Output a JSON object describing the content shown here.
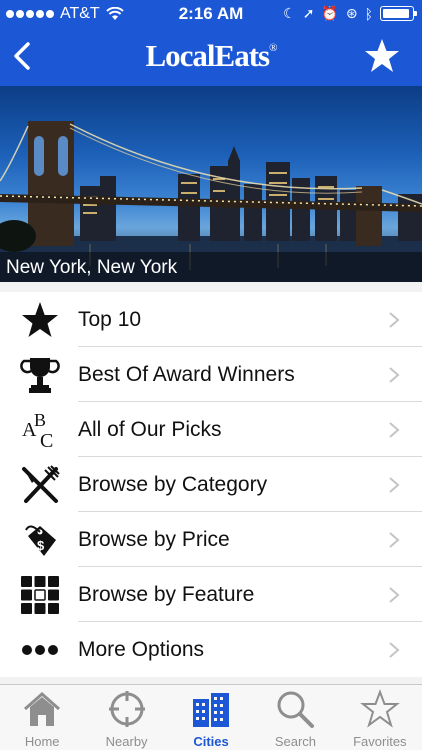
{
  "status": {
    "carrier": "AT&T",
    "time": "2:16 AM"
  },
  "nav": {
    "title": "LocalEats",
    "title_mark": "®"
  },
  "hero": {
    "caption": "New York, New York"
  },
  "menu": [
    {
      "label": "Top 10",
      "icon": "star-icon"
    },
    {
      "label": "Best Of Award Winners",
      "icon": "trophy-icon"
    },
    {
      "label": "All of Our Picks",
      "icon": "abc-icon"
    },
    {
      "label": "Browse by Category",
      "icon": "fork-knife-icon"
    },
    {
      "label": "Browse by Price",
      "icon": "price-tag-icon"
    },
    {
      "label": "Browse by Feature",
      "icon": "grid-icon"
    },
    {
      "label": "More Options",
      "icon": "more-icon"
    }
  ],
  "tabs": [
    {
      "label": "Home",
      "icon": "home-icon"
    },
    {
      "label": "Nearby",
      "icon": "crosshair-icon"
    },
    {
      "label": "Cities",
      "icon": "buildings-icon"
    },
    {
      "label": "Search",
      "icon": "magnifier-icon"
    },
    {
      "label": "Favorites",
      "icon": "star-outline-icon"
    }
  ],
  "colors": {
    "brand": "#1c58d6",
    "tab_inactive": "#8e8e8e"
  }
}
